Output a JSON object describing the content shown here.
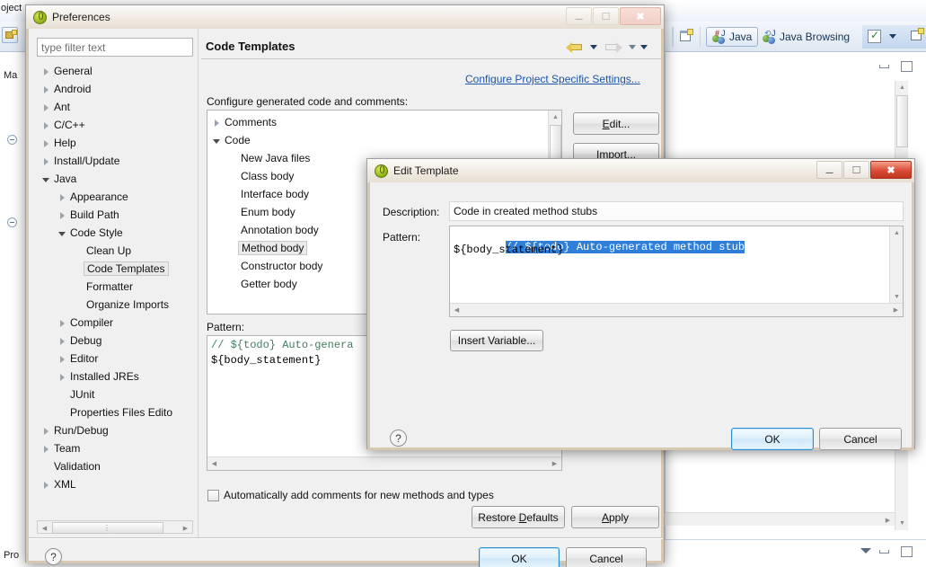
{
  "ide": {
    "perspective_buttons": [
      {
        "label": "Java",
        "icon": "java-perspective-icon",
        "active": true
      },
      {
        "label": "Java Browsing",
        "icon": "java-browsing-perspective-icon",
        "active": false
      }
    ],
    "new_window_icon": "new-window-icon",
    "checkbox_toolbar_icon": "checkmark-toolbar-icon",
    "package_icon": "new-package-icon",
    "left_tab_label": "oject",
    "left_item_label": "Ma",
    "bottom_tab_label": "Pro"
  },
  "preferences": {
    "title": "Preferences",
    "icon": "eclipse-icon",
    "window_buttons": {
      "minimize": "minimize-icon",
      "maximize": "maximize-icon",
      "close": "close-icon"
    },
    "filter": {
      "placeholder": "type filter text",
      "value": ""
    },
    "tree": [
      {
        "label": "General",
        "indent": 0,
        "twisty": "collapsed",
        "selected": false
      },
      {
        "label": "Android",
        "indent": 0,
        "twisty": "collapsed",
        "selected": false
      },
      {
        "label": "Ant",
        "indent": 0,
        "twisty": "collapsed",
        "selected": false
      },
      {
        "label": "C/C++",
        "indent": 0,
        "twisty": "collapsed",
        "selected": false
      },
      {
        "label": "Help",
        "indent": 0,
        "twisty": "collapsed",
        "selected": false
      },
      {
        "label": "Install/Update",
        "indent": 0,
        "twisty": "collapsed",
        "selected": false
      },
      {
        "label": "Java",
        "indent": 0,
        "twisty": "expanded",
        "selected": false
      },
      {
        "label": "Appearance",
        "indent": 1,
        "twisty": "collapsed",
        "selected": false
      },
      {
        "label": "Build Path",
        "indent": 1,
        "twisty": "collapsed",
        "selected": false
      },
      {
        "label": "Code Style",
        "indent": 1,
        "twisty": "expanded",
        "selected": false
      },
      {
        "label": "Clean Up",
        "indent": 2,
        "twisty": "none",
        "selected": false
      },
      {
        "label": "Code Templates",
        "indent": 2,
        "twisty": "none",
        "selected": true
      },
      {
        "label": "Formatter",
        "indent": 2,
        "twisty": "none",
        "selected": false
      },
      {
        "label": "Organize Imports",
        "indent": 2,
        "twisty": "none",
        "selected": false
      },
      {
        "label": "Compiler",
        "indent": 1,
        "twisty": "collapsed",
        "selected": false
      },
      {
        "label": "Debug",
        "indent": 1,
        "twisty": "collapsed",
        "selected": false
      },
      {
        "label": "Editor",
        "indent": 1,
        "twisty": "collapsed",
        "selected": false
      },
      {
        "label": "Installed JREs",
        "indent": 1,
        "twisty": "collapsed",
        "selected": false
      },
      {
        "label": "JUnit",
        "indent": 1,
        "twisty": "none",
        "selected": false
      },
      {
        "label": "Properties Files Edito",
        "indent": 1,
        "twisty": "none",
        "selected": false
      },
      {
        "label": "Run/Debug",
        "indent": 0,
        "twisty": "collapsed",
        "selected": false
      },
      {
        "label": "Team",
        "indent": 0,
        "twisty": "collapsed",
        "selected": false
      },
      {
        "label": "Validation",
        "indent": 0,
        "twisty": "none",
        "selected": false
      },
      {
        "label": "XML",
        "indent": 0,
        "twisty": "collapsed",
        "selected": false
      }
    ],
    "page": {
      "title": "Code Templates",
      "nav": {
        "back_icon": "back-arrow-icon",
        "back_menu_icon": "back-dropdown-icon",
        "forward_icon": "forward-arrow-icon",
        "forward_menu_icon": "forward-dropdown-icon",
        "menu_icon": "view-menu-icon"
      },
      "project_specific_link": "Configure Project Specific Settings...",
      "configure_label": "Configure generated code and comments:",
      "templates_tree": [
        {
          "label": "Comments",
          "indent": 0,
          "twisty": "collapsed",
          "selected": false
        },
        {
          "label": "Code",
          "indent": 0,
          "twisty": "expanded",
          "selected": false
        },
        {
          "label": "New Java files",
          "indent": 1,
          "twisty": "none",
          "selected": false
        },
        {
          "label": "Class body",
          "indent": 1,
          "twisty": "none",
          "selected": false
        },
        {
          "label": "Interface body",
          "indent": 1,
          "twisty": "none",
          "selected": false
        },
        {
          "label": "Enum body",
          "indent": 1,
          "twisty": "none",
          "selected": false
        },
        {
          "label": "Annotation body",
          "indent": 1,
          "twisty": "none",
          "selected": false
        },
        {
          "label": "Method body",
          "indent": 1,
          "twisty": "none",
          "selected": true
        },
        {
          "label": "Constructor body",
          "indent": 1,
          "twisty": "none",
          "selected": false
        },
        {
          "label": "Getter body",
          "indent": 1,
          "twisty": "none",
          "selected": false
        }
      ],
      "side_buttons": [
        {
          "label": "Edit...",
          "mnemonic": "E"
        },
        {
          "label": "Import...",
          "mnemonic": "I"
        }
      ],
      "pattern_label": "Pattern:",
      "pattern_preview": {
        "line1": "// ${todo} Auto-genera",
        "line2": "${body_statement}"
      },
      "auto_comments_checkbox": {
        "label": "Automatically add comments for new methods and types",
        "checked": false
      },
      "restore_defaults": "Restore Defaults",
      "restore_defaults_mnemonic": "D",
      "apply": "Apply",
      "apply_mnemonic": "A"
    },
    "ok": "OK",
    "cancel": "Cancel",
    "help_icon": "help-icon"
  },
  "edit_template": {
    "title": "Edit Template",
    "icon": "eclipse-icon",
    "window_buttons": {
      "minimize": "minimize-icon",
      "maximize": "maximize-icon",
      "close": "close-icon"
    },
    "description_label": "Description:",
    "description_value": "Code in created method stubs",
    "pattern_label": "Pattern:",
    "pattern_line1": "// ${todo} Auto-generated method stub",
    "pattern_line2": "${body_statement}",
    "insert_variable": "Insert Variable...",
    "ok": "OK",
    "cancel": "Cancel",
    "help_icon": "help-icon"
  },
  "colors": {
    "selection_blue": "#2f7fd8",
    "comment_green": "#3f7f5f",
    "link_blue": "#1b55a8",
    "close_red": "#d94b36",
    "default_button_border": "#2c8fd0"
  }
}
